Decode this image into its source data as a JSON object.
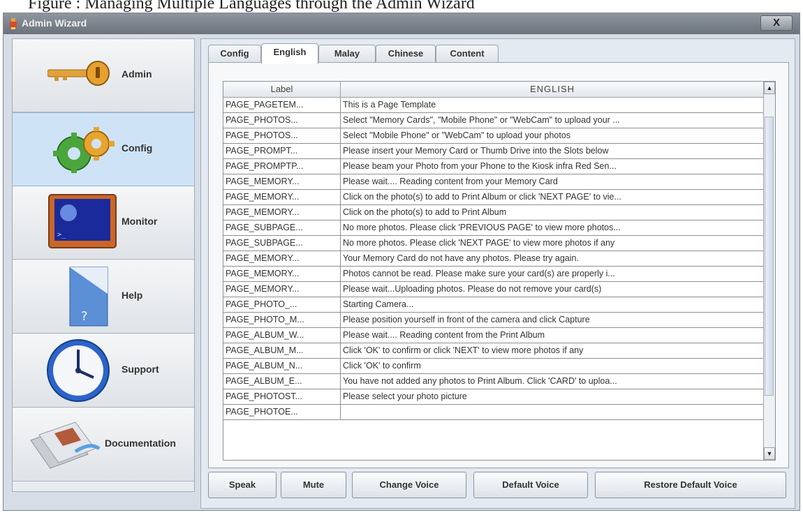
{
  "caption_strip": "Figure : Managing Multiple Languages through the Admin Wizard",
  "window": {
    "title": "Admin Wizard",
    "close_label": "X"
  },
  "sidebar": {
    "items": [
      {
        "label": "Admin",
        "icon": "key-icon"
      },
      {
        "label": "Config",
        "icon": "gears-icon",
        "active": true
      },
      {
        "label": "Monitor",
        "icon": "monitor-icon"
      },
      {
        "label": "Help",
        "icon": "help-document-icon"
      },
      {
        "label": "Support",
        "icon": "clock-icon"
      },
      {
        "label": "Documentation",
        "icon": "documents-icon"
      }
    ]
  },
  "tabs": [
    "Config",
    "English",
    "Malay",
    "Chinese",
    "Content"
  ],
  "active_tab": "English",
  "table": {
    "columns": [
      "Label",
      "ENGLISH"
    ],
    "rows": [
      [
        "PAGE_PAGETEM...",
        "This is a Page Template"
      ],
      [
        "PAGE_PHOTOS...",
        "Select \"Memory Cards\", \"Mobile Phone\" or \"WebCam\" to upload your ..."
      ],
      [
        "PAGE_PHOTOS...",
        "Select \"Mobile Phone\" or \"WebCam\" to upload your photos"
      ],
      [
        "PAGE_PROMPT...",
        "Please insert your Memory Card or Thumb Drive into the Slots below"
      ],
      [
        "PAGE_PROMPTP...",
        "Please beam your Photo from your Phone to the Kiosk infra Red Sen..."
      ],
      [
        "PAGE_MEMORY...",
        "Please wait.... Reading content from your Memory Card"
      ],
      [
        "PAGE_MEMORY...",
        "Click on the photo(s) to add to Print Album or click 'NEXT PAGE' to vie..."
      ],
      [
        "PAGE_MEMORY...",
        "Click on the photo(s) to add to Print Album"
      ],
      [
        "PAGE_SUBPAGE...",
        "No more photos. Please click 'PREVIOUS PAGE' to view more photos..."
      ],
      [
        "PAGE_SUBPAGE...",
        "No more photos. Please click 'NEXT PAGE' to view more photos if any"
      ],
      [
        "PAGE_MEMORY...",
        "Your Memory Card do not have any photos. Please try again."
      ],
      [
        "PAGE_MEMORY...",
        "Photos cannot be read. Please make sure your card(s) are properly i..."
      ],
      [
        "PAGE_MEMORY...",
        "Please wait...Uploading photos. Please do not remove your card(s)"
      ],
      [
        "PAGE_PHOTO_...",
        "Starting Camera..."
      ],
      [
        "PAGE_PHOTO_M...",
        "Please position yourself in front of the camera and click Capture"
      ],
      [
        "PAGE_ALBUM_W...",
        "Please wait.... Reading content from the Print Album"
      ],
      [
        "PAGE_ALBUM_M...",
        "Click 'OK' to confirm or click 'NEXT' to view more photos if any"
      ],
      [
        "PAGE_ALBUM_N...",
        "Click 'OK' to confirm"
      ],
      [
        "PAGE_ALBUM_E...",
        "You have not added any photos to Print Album. Click 'CARD' to uploa..."
      ],
      [
        "PAGE_PHOTOST...",
        "Please select your photo picture"
      ],
      [
        "PAGE_PHOTOE...",
        ""
      ]
    ]
  },
  "buttons": [
    "Speak",
    "Mute",
    "Change Voice",
    "Default Voice",
    "Restore Default Voice"
  ],
  "colors": {
    "active_nav": "#cfe3f6",
    "title_bar": "#7a828b",
    "panel": "#e4eaf1"
  }
}
